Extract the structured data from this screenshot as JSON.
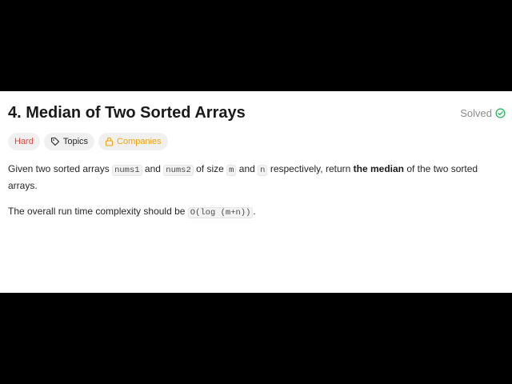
{
  "problem": {
    "title": "4. Median of Two Sorted Arrays",
    "status": "Solved",
    "status_color": "#2cbb5d"
  },
  "tags": {
    "difficulty": "Hard",
    "topics": "Topics",
    "companies": "Companies",
    "difficulty_color": "#e0443b",
    "companies_color": "#f0a30a"
  },
  "description": {
    "p1_part1": "Given two sorted arrays ",
    "code_nums1": "nums1",
    "p1_part2": " and ",
    "code_nums2": "nums2",
    "p1_part3": " of size ",
    "code_m": "m",
    "p1_part4": " and ",
    "code_n": "n",
    "p1_part5": " respectively, return ",
    "p1_bold": "the median",
    "p1_part6": " of the two sorted arrays.",
    "p2_part1": "The overall run time complexity should be ",
    "code_complexity": "O(log (m+n))",
    "p2_part2": "."
  }
}
